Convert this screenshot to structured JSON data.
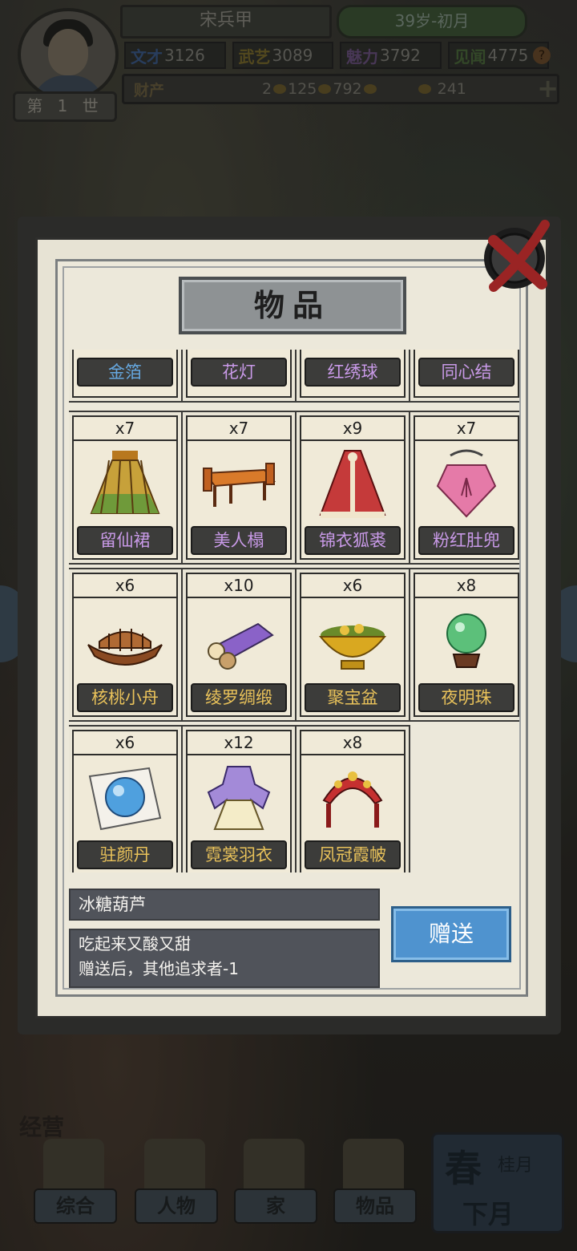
{
  "header": {
    "name": "宋兵甲",
    "age": "39岁-初月",
    "generation": "第 1 世",
    "stats": [
      {
        "label": "文才",
        "value": "3126"
      },
      {
        "label": "武艺",
        "value": "3089"
      },
      {
        "label": "魅力",
        "value": "3792"
      },
      {
        "label": "见闻",
        "value": "4775"
      }
    ],
    "wealth_label": "财产",
    "wealth": {
      "gold": "2",
      "silver": "125",
      "copper": "792",
      "reputation": "241"
    }
  },
  "modal": {
    "title": "物品",
    "partial_items": [
      "金箔",
      "花灯",
      "红绣球",
      "同心结"
    ],
    "items": [
      {
        "name": "留仙裙",
        "count": "x7",
        "color": "purple",
        "icon": "skirt-icon"
      },
      {
        "name": "美人榻",
        "count": "x7",
        "color": "purple",
        "icon": "couch-icon"
      },
      {
        "name": "锦衣狐裘",
        "count": "x9",
        "color": "purple",
        "icon": "cloak-icon"
      },
      {
        "name": "粉红肚兜",
        "count": "x7",
        "color": "purple",
        "icon": "bib-icon"
      },
      {
        "name": "核桃小舟",
        "count": "x6",
        "color": "gold",
        "icon": "boat-icon"
      },
      {
        "name": "绫罗绸缎",
        "count": "x10",
        "color": "gold",
        "icon": "silk-icon"
      },
      {
        "name": "聚宝盆",
        "count": "x6",
        "color": "gold",
        "icon": "treasure-bowl-icon"
      },
      {
        "name": "夜明珠",
        "count": "x8",
        "color": "gold",
        "icon": "pearl-icon"
      },
      {
        "name": "驻颜丹",
        "count": "x6",
        "color": "gold",
        "icon": "pill-icon"
      },
      {
        "name": "霓裳羽衣",
        "count": "x12",
        "color": "gold",
        "icon": "dress-icon"
      },
      {
        "name": "凤冠霞帔",
        "count": "x8",
        "color": "gold",
        "icon": "crown-icon"
      }
    ],
    "selected": {
      "name": "冰糖葫芦",
      "description_1": "吃起来又酸又甜",
      "description_2": "赠送后，其他追求者-1"
    },
    "give_button": "赠送"
  },
  "bottom_nav": {
    "business": "经营",
    "items": [
      "综合",
      "人物",
      "家",
      "物品"
    ],
    "season": {
      "big": "春",
      "small": "桂月",
      "next": "下月"
    }
  },
  "colors": {
    "blue_name": "#66a8e0",
    "purple_name": "#c99ae8",
    "gold_name": "#e9c25a",
    "give_button": "#4f93cf"
  }
}
